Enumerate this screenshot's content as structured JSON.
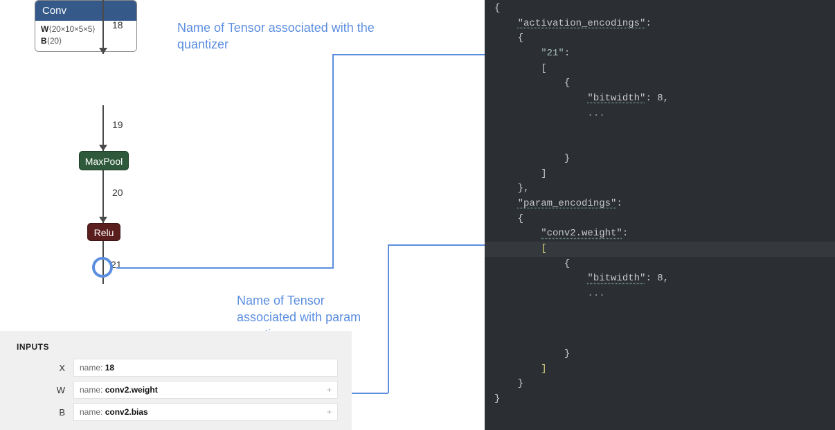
{
  "graph": {
    "edge_in_label": "18",
    "conv": {
      "title": "Conv",
      "w_prefix": "W",
      "w_dims": "⟨20×10×5×5⟩",
      "b_prefix": "B",
      "b_dims": "⟨20⟩"
    },
    "edge_conv_maxpool": "19",
    "maxpool": "MaxPool",
    "edge_maxpool_relu": "20",
    "relu": "Relu",
    "edge_out": "21"
  },
  "annotations": {
    "act": "Name of Tensor associated with the\nquantizer",
    "param": "Name of Tensor\nassociated with param\nquantizer"
  },
  "inputs": {
    "title": "INPUTS",
    "rows": [
      {
        "key": "X",
        "label": "name:",
        "value": "18",
        "expandable": false
      },
      {
        "key": "W",
        "label": "name:",
        "value": "conv2.weight",
        "expandable": true
      },
      {
        "key": "B",
        "label": "name:",
        "value": "conv2.bias",
        "expandable": true
      }
    ]
  },
  "code": {
    "lines": [
      "{",
      "    \"activation_encodings\":",
      "    {",
      "        \"21\":",
      "        [",
      "            {",
      "                \"bitwidth\": 8,",
      "                ...",
      "",
      "",
      "            }",
      "        ]",
      "    },",
      "    \"param_encodings\":",
      "    {",
      "        \"conv2.weight\":",
      "        [",
      "            {",
      "                \"bitwidth\": 8,",
      "                ...",
      "",
      "",
      "",
      "            }",
      "        ]",
      "    }",
      "}"
    ],
    "activation_key": "\"activation_encodings\"",
    "param_key": "\"param_encodings\"",
    "tensor21": "\"21\"",
    "conv2w": "\"conv2.weight\"",
    "bw_key": "\"bitwidth\"",
    "bw_val": "8",
    "ellipsis": "..."
  },
  "chart_data": {
    "type": "diagram",
    "description": "ONNX-style computation graph showing a Conv layer (W 20x10x5x5, B 20) followed by MaxPool then Relu; edge tensor names 18→19→20→21. Annotations map output tensor name 21 to activation_encodings key and Conv weight tensor name conv2.weight to param_encodings key in the JSON snippet on the right. A node-inputs panel lists X=name:18, W=name:conv2.weight, B=name:conv2.bias.",
    "graph_nodes": [
      "Conv",
      "MaxPool",
      "Relu"
    ],
    "graph_edges": [
      "18",
      "19",
      "20",
      "21"
    ],
    "encodings": {
      "activation_encodings": {
        "21": [
          {
            "bitwidth": 8
          }
        ]
      },
      "param_encodings": {
        "conv2.weight": [
          {
            "bitwidth": 8
          }
        ]
      }
    }
  }
}
